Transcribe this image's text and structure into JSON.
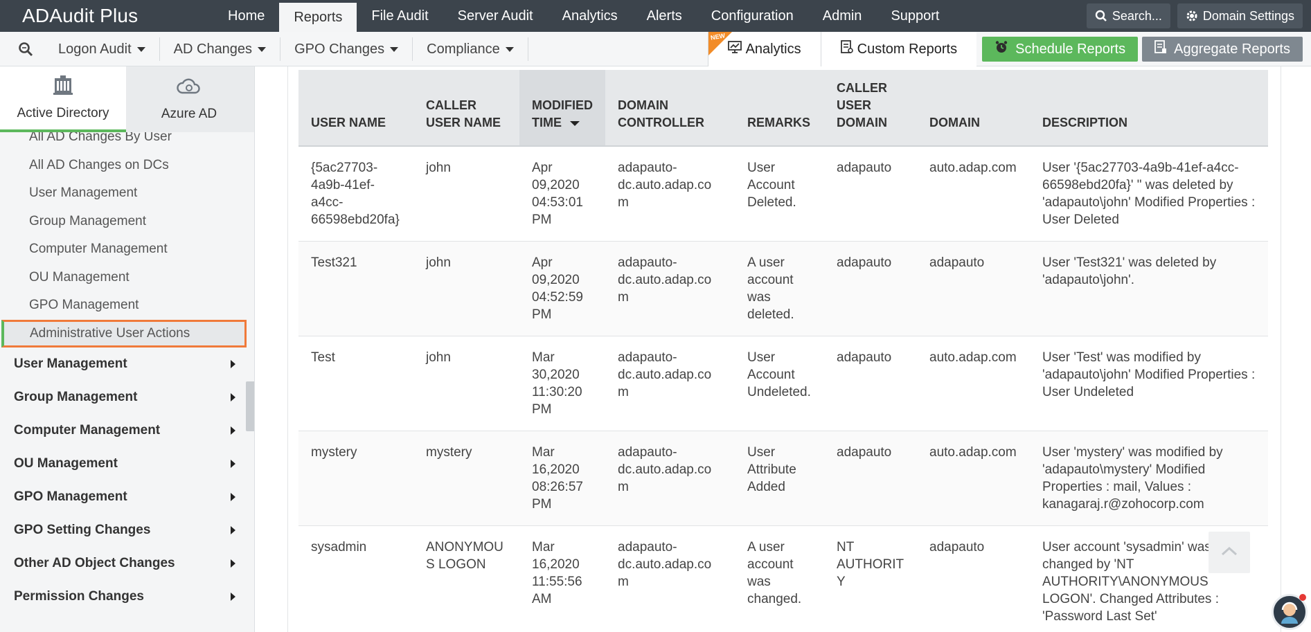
{
  "app": {
    "title": "ADAudit Plus"
  },
  "topnav": {
    "items": [
      {
        "label": "Home"
      },
      {
        "label": "Reports"
      },
      {
        "label": "File Audit"
      },
      {
        "label": "Server Audit"
      },
      {
        "label": "Analytics"
      },
      {
        "label": "Alerts"
      },
      {
        "label": "Configuration"
      },
      {
        "label": "Admin"
      },
      {
        "label": "Support"
      }
    ],
    "active": "Reports",
    "search_label": "Search...",
    "domain_settings_label": "Domain Settings"
  },
  "subnav": {
    "items": [
      {
        "label": "Logon Audit"
      },
      {
        "label": "AD Changes"
      },
      {
        "label": "GPO Changes"
      },
      {
        "label": "Compliance"
      }
    ],
    "analytics_label": "Analytics",
    "new_badge": "NEW",
    "custom_reports_label": "Custom Reports",
    "schedule_reports_label": "Schedule Reports",
    "aggregate_reports_label": "Aggregate Reports"
  },
  "sidebar": {
    "tabs": [
      {
        "label": "Active Directory"
      },
      {
        "label": "Azure AD"
      }
    ],
    "reports": [
      {
        "label": "All AD Changes By User"
      },
      {
        "label": "All AD Changes on DCs"
      },
      {
        "label": "User Management"
      },
      {
        "label": "Group Management"
      },
      {
        "label": "Computer Management"
      },
      {
        "label": "OU Management"
      },
      {
        "label": "GPO Management"
      },
      {
        "label": "Administrative User Actions"
      }
    ],
    "selected_report": "Administrative User Actions",
    "groups": [
      {
        "label": "User Management"
      },
      {
        "label": "Group Management"
      },
      {
        "label": "Computer Management"
      },
      {
        "label": "OU Management"
      },
      {
        "label": "GPO Management"
      },
      {
        "label": "GPO Setting Changes"
      },
      {
        "label": "Other AD Object Changes"
      },
      {
        "label": "Permission Changes"
      }
    ]
  },
  "table": {
    "columns": [
      {
        "label": "USER NAME"
      },
      {
        "label": "CALLER USER NAME"
      },
      {
        "label": "MODIFIED TIME"
      },
      {
        "label": "DOMAIN CONTROLLER"
      },
      {
        "label": "REMARKS"
      },
      {
        "label": "CALLER USER DOMAIN"
      },
      {
        "label": "DOMAIN"
      },
      {
        "label": "DESCRIPTION"
      }
    ],
    "sorted_column": "MODIFIED TIME",
    "rows": [
      {
        "user": "{5ac27703-4a9b-41ef-a4cc-66598ebd20fa}",
        "caller": "john",
        "time": "Apr 09,2020 04:53:01 PM",
        "dc": "adapauto-dc.auto.adap.com",
        "remarks": "User Account Deleted.",
        "caller_domain": "adapauto",
        "domain": "auto.adap.com",
        "description": "User '{5ac27703-4a9b-41ef-a4cc-66598ebd20fa}' \" was deleted by 'adapauto\\john' Modified Properties : User Deleted"
      },
      {
        "user": "Test321",
        "caller": "john",
        "time": "Apr 09,2020 04:52:59 PM",
        "dc": "adapauto-dc.auto.adap.com",
        "remarks": "A user account was deleted.",
        "caller_domain": "adapauto",
        "domain": "adapauto",
        "description": "User 'Test321' was deleted by 'adapauto\\john'."
      },
      {
        "user": "Test",
        "caller": "john",
        "time": "Mar 30,2020 11:30:20 PM",
        "dc": "adapauto-dc.auto.adap.com",
        "remarks": "User Account Undeleted.",
        "caller_domain": "adapauto",
        "domain": "auto.adap.com",
        "description": "User 'Test' was modified by 'adapauto\\john' Modified Properties : User Undeleted"
      },
      {
        "user": "mystery",
        "caller": "mystery",
        "time": "Mar 16,2020 08:26:57 PM",
        "dc": "adapauto-dc.auto.adap.com",
        "remarks": "User Attribute Added",
        "caller_domain": "adapauto",
        "domain": "auto.adap.com",
        "description": "User 'mystery' was modified by 'adapauto\\mystery' Modified Properties : mail, Values : kanagaraj.r@zohocorp.com"
      },
      {
        "user": "sysadmin",
        "caller": "ANONYMOUS LOGON",
        "time": "Mar 16,2020 11:55:56 AM",
        "dc": "adapauto-dc.auto.adap.com",
        "remarks": "A user account was changed.",
        "caller_domain": "NT AUTHORITY",
        "domain": "adapauto",
        "description": "User account 'sysadmin' was changed by 'NT AUTHORITY\\ANONYMOUS LOGON'. Changed Attributes : 'Password Last Set'"
      }
    ]
  },
  "colors": {
    "topbar": "#3c444c",
    "accent_green": "#5cb85c",
    "selection_orange": "#f07a3a",
    "new_badge": "#f28c28"
  }
}
